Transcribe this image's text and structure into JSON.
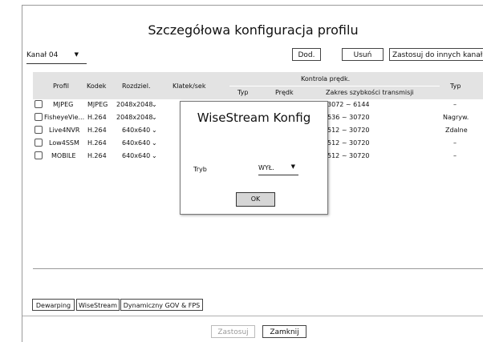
{
  "dialog": {
    "title": "Szczegółowa konfiguracja profilu",
    "channel": "Kanał 04",
    "buttons": {
      "add": "Dod.",
      "delete": "Usuń",
      "apply_others": "Zastosuj do innych kanałów"
    },
    "table": {
      "headers": {
        "profile": "Profil",
        "codec": "Kodek",
        "resolution": "Rozdziel.",
        "fps": "Klatek/sek",
        "rate_control": "Kontrola prędk.",
        "type": "Typ",
        "speed": "Prędk",
        "range": "Zakres szybkości transmisji",
        "type2": "Typ"
      },
      "rows": [
        {
          "profile": "MJPEG",
          "codec": "MJPEG",
          "resolution": "2048x2048",
          "range": "3072 ~ 6144",
          "type": "–",
          "partial": "6144"
        },
        {
          "profile": "FisheyeVie...",
          "codec": "H.264",
          "resolution": "2048x2048",
          "range": "1536 ~ 30720",
          "type": "Nagryw."
        },
        {
          "profile": "Live4NVR",
          "codec": "H.264",
          "resolution": "640x640",
          "range": "512 ~ 30720",
          "type": "Zdalne"
        },
        {
          "profile": "Low4SSM",
          "codec": "H.264",
          "resolution": "640x640",
          "range": "512 ~ 30720",
          "type": "–"
        },
        {
          "profile": "MOBILE",
          "codec": "H.264",
          "resolution": "640x640",
          "range": "512 ~ 30720",
          "type": "–"
        }
      ]
    },
    "tabs": {
      "dewarping": "Dewarping",
      "wisestream": "WiseStream",
      "dynamic": "Dynamiczny GOV & FPS"
    },
    "footer": {
      "apply": "Zastosuj",
      "close": "Zamknij"
    }
  },
  "popup": {
    "title": "WiseStream Konfig",
    "mode_label": "Tryb",
    "mode_value": "WYŁ.",
    "ok": "OK"
  }
}
